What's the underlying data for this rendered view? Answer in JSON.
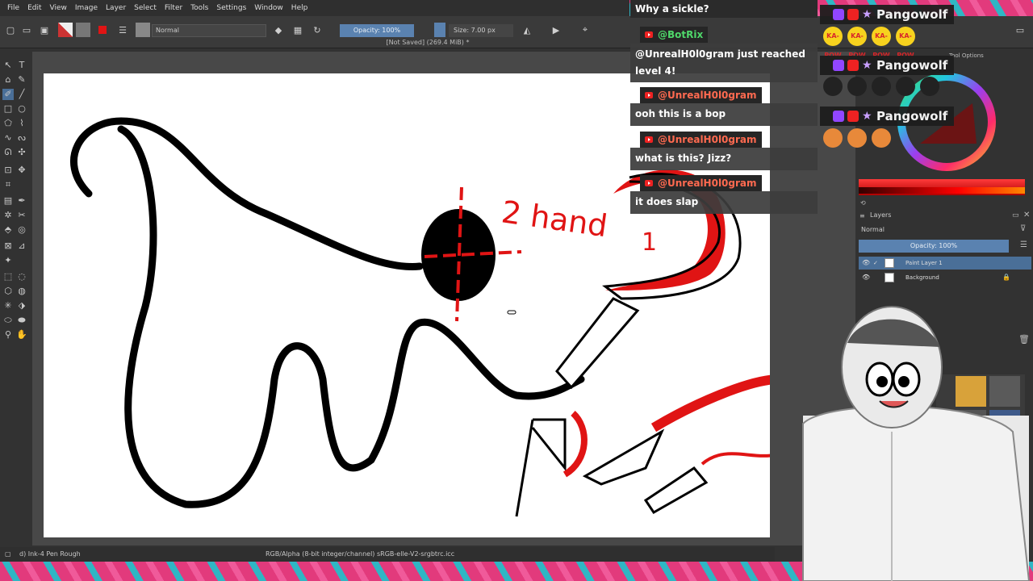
{
  "menu": [
    "File",
    "Edit",
    "View",
    "Image",
    "Layer",
    "Select",
    "Filter",
    "Tools",
    "Settings",
    "Window",
    "Help"
  ],
  "toolbar": {
    "blend_mode": "Normal",
    "opacity": "Opacity: 100%",
    "size": "Size: 7.00 px"
  },
  "document_title": "[Not Saved]  (269.4 MiB) *",
  "status": {
    "brush": "d) Ink-4 Pen Rough",
    "color_profile": "RGB/Alpha (8-bit integer/channel)  sRGB-elle-V2-srgbtrc.icc"
  },
  "canvas_text": {
    "annotation_1": "2 hand",
    "annotation_2": "1"
  },
  "layers_panel": {
    "title": "Layers",
    "blend_mode": "Normal",
    "opacity": "Opacity:  100%",
    "layers": [
      {
        "name": "Paint Layer 1",
        "selected": true
      },
      {
        "name": "Background",
        "selected": false
      }
    ]
  },
  "docker_tab": "Tool Options",
  "chat": {
    "top_message": "Why a sickle?",
    "messages": [
      {
        "handle": "@BotRix",
        "text": "@UnrealH0l0gram just reached level 4!",
        "bot": true
      },
      {
        "handle": "@UnrealH0l0gram",
        "text": "ooh this is a bop",
        "bot": false
      },
      {
        "handle": "@UnrealH0l0gram",
        "text": "what is this? Jizz?",
        "bot": false
      },
      {
        "handle": "@UnrealH0l0gram",
        "text": "it does slap",
        "bot": false
      }
    ]
  },
  "alerts": [
    {
      "name": "Pangowolf",
      "emote_text": "KA-POW"
    },
    {
      "name": "Pangowolf",
      "emote_text": ""
    },
    {
      "name": "Pangowolf",
      "emote_text": ""
    }
  ],
  "colors": {
    "selection": "#4a6f98",
    "ink": "#000000",
    "red": "#e01414",
    "youtube": "#e22222",
    "twitch": "#9146ff"
  }
}
